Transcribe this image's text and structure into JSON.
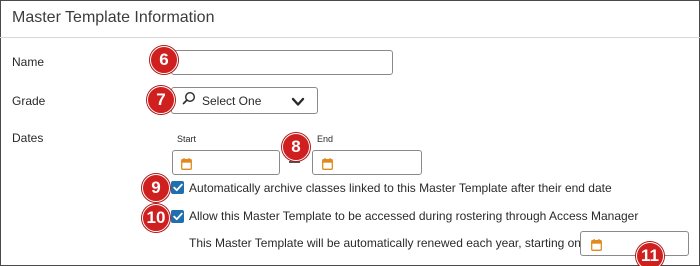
{
  "section": {
    "title": "Master Template Information"
  },
  "fields": {
    "name": {
      "label": "Name",
      "value": ""
    },
    "grade": {
      "label": "Grade",
      "selected": "Select One"
    },
    "dates": {
      "label": "Dates",
      "start_label": "Start",
      "end_label": "End",
      "start_value": "",
      "end_value": ""
    }
  },
  "options": {
    "archive_label": "Automatically archive classes linked to this Master Template after their end date",
    "archive_checked": true,
    "access_label": "Allow this Master Template to be accessed during rostering through Access Manager",
    "access_checked": true,
    "renew_label": "This Master Template will be automatically renewed each year, starting on",
    "renew_value": ""
  },
  "callouts": [
    "6",
    "7",
    "8",
    "9",
    "10",
    "11"
  ],
  "colors": {
    "callout": "#cf1f1f",
    "checkbox": "#1d6fb0",
    "calendar_icon": "#e08a1e"
  },
  "icons": {
    "search": "search-icon",
    "chevron": "chevron-down-icon",
    "calendar": "calendar-icon",
    "check": "checkmark-icon"
  }
}
